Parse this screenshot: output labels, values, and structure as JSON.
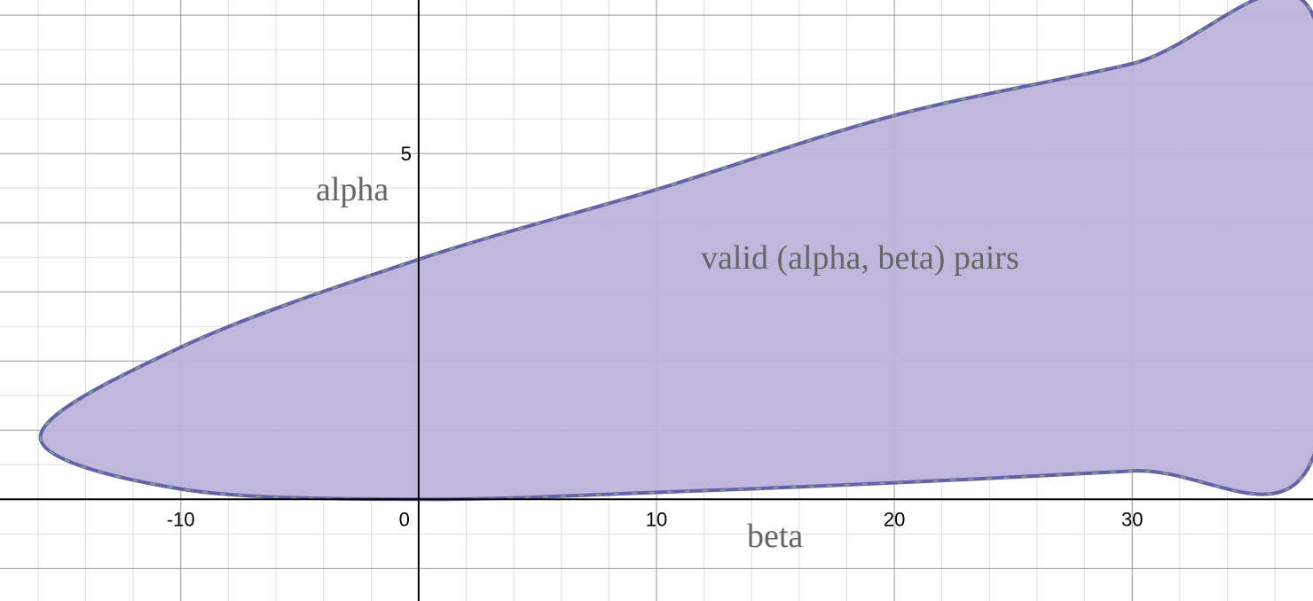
{
  "chart_data": {
    "type": "area",
    "title": "",
    "xlabel": "beta",
    "ylabel": "alpha",
    "xlim": [
      -17.6,
      37.6
    ],
    "ylim": [
      -1.47,
      7.22
    ],
    "grid": true,
    "x_ticks": [
      {
        "value": -10,
        "label": "-10"
      },
      {
        "value": 0,
        "label": "0"
      },
      {
        "value": 10,
        "label": "10"
      },
      {
        "value": 20,
        "label": "20"
      },
      {
        "value": 30,
        "label": "30"
      }
    ],
    "y_ticks": [
      {
        "value": 5,
        "label": "5"
      }
    ],
    "annotations": {
      "region_label": "valid (alpha, beta) pairs",
      "x_axis_name": "beta",
      "y_axis_name": "alpha"
    },
    "series": [
      {
        "kind": "region",
        "boundary_points": [
          {
            "beta": 0,
            "alpha": 0
          },
          {
            "beta": 10,
            "alpha": 0.1
          },
          {
            "beta": 20,
            "alpha": 0.24
          },
          {
            "beta": 30,
            "alpha": 0.41
          },
          {
            "beta": 37.6,
            "alpha": 0.6
          },
          {
            "beta": 37.6,
            "alpha": 7.0
          },
          {
            "beta": 30,
            "alpha": 6.3
          },
          {
            "beta": 20,
            "alpha": 5.55
          },
          {
            "beta": 10,
            "alpha": 4.48
          },
          {
            "beta": 0,
            "alpha": 3.47
          },
          {
            "beta": -10,
            "alpha": 2.2
          },
          {
            "beta": -15.9,
            "alpha": 0.9
          },
          {
            "beta": -10,
            "alpha": 0.15
          }
        ],
        "fill_color": "#BDB4DA",
        "edge_color": "#6561A8",
        "edge_dash_color": "#7FA28D"
      }
    ]
  },
  "colors": {
    "axis": "#000000",
    "major_grid": "#999999",
    "minor_grid": "#dddddd",
    "region_fill": "#BDB4DA",
    "region_edge": "#6561A8"
  }
}
